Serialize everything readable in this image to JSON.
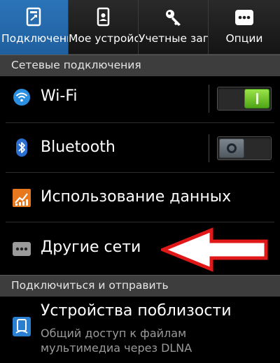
{
  "tabs": [
    {
      "label": "Подключения",
      "icon": "connections-icon",
      "active": true
    },
    {
      "label": "Мое устройство",
      "icon": "device-icon",
      "active": false
    },
    {
      "label": "Учетные записи",
      "icon": "key-icon",
      "active": false
    },
    {
      "label": "Опции",
      "icon": "more-icon",
      "active": false
    }
  ],
  "sections": {
    "network": "Сетевые подключения",
    "connect_share": "Подключиться и отправить"
  },
  "items": {
    "wifi": {
      "label": "Wi-Fi",
      "icon": "wifi-icon",
      "toggle": "on"
    },
    "bluetooth": {
      "label": "Bluetooth",
      "icon": "bluetooth-icon",
      "toggle": "off"
    },
    "data_usage": {
      "label": "Использование данных",
      "icon": "data-usage-icon"
    },
    "other_networks": {
      "label": "Другие сети",
      "icon": "more-networks-icon"
    },
    "nearby_devices": {
      "label": "Устройства поблизости",
      "subtitle_line1": "Общий доступ к файлам",
      "subtitle_line2": "мультимедиа через DLNA",
      "icon": "nearby-devices-icon"
    }
  },
  "colors": {
    "active_tab": "#2b74b8",
    "switch_on": "#6cc42a",
    "annotation_arrow": "#e01818",
    "section_header": "#3d3d3d"
  }
}
